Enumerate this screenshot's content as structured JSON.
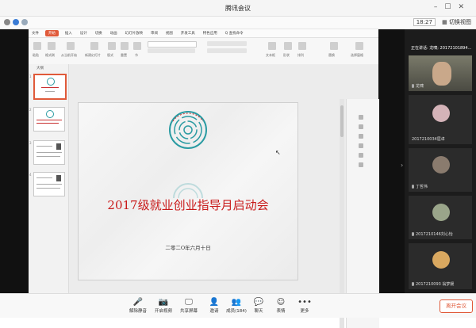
{
  "window": {
    "title": "腾讯会议"
  },
  "infobar": {
    "time": "18:27",
    "switch_view_label": "切换视图"
  },
  "wps": {
    "tabs": [
      "文件",
      "开始",
      "插入",
      "设计",
      "切换",
      "动画",
      "幻灯片放映",
      "审阅",
      "视图",
      "开发工具",
      "特色应用"
    ],
    "search_label": "Q 查找命令",
    "ribbon_labels": [
      "粘贴",
      "格式刷",
      "从当前开始",
      "新建幻灯片",
      "版式",
      "重置",
      "节",
      "文本框",
      "形状",
      "排列",
      "替换",
      "选择窗格"
    ],
    "thumb_tabs": [
      "大纲",
      "幻灯片"
    ],
    "thumb_numbers": [
      "1",
      "2",
      "3",
      "4"
    ]
  },
  "slide": {
    "title": "2017级就业创业指导月启动会",
    "date": "二零二O年六月十日"
  },
  "panel": {
    "speaker_label": "正在讲话: 龙啸; 20172101894...",
    "participants": [
      {
        "name": "龙啸",
        "avatar": "speaker"
      },
      {
        "name": "2017210034屈卓",
        "avatar": "flower"
      },
      {
        "name": "丁哲伟",
        "avatar": "person"
      },
      {
        "name": "2017210146刘心怡",
        "avatar": "plant"
      },
      {
        "name": "2017210093 翁梦媛",
        "avatar": "cat"
      }
    ]
  },
  "toolbar": {
    "items": [
      {
        "label": "解除静音",
        "icon": "mic-off-icon",
        "glyph": "🎤"
      },
      {
        "label": "开启视频",
        "icon": "camera-off-icon",
        "glyph": "📷"
      },
      {
        "label": "共享屏幕",
        "icon": "share-screen-icon",
        "glyph": "🖵"
      },
      {
        "label": "邀请",
        "icon": "invite-icon",
        "glyph": "👤"
      },
      {
        "label": "成员(184)",
        "icon": "members-icon",
        "glyph": "👥"
      },
      {
        "label": "聊天",
        "icon": "chat-icon",
        "glyph": "💬"
      },
      {
        "label": "表情",
        "icon": "emoji-icon",
        "glyph": "☺"
      },
      {
        "label": "更多",
        "icon": "more-icon",
        "glyph": "•••"
      }
    ],
    "leave_label": "离开会议"
  },
  "colors": {
    "accent": "#e05a3a",
    "title_red": "#c91b1b",
    "panel_bg": "#1c1c1c"
  }
}
